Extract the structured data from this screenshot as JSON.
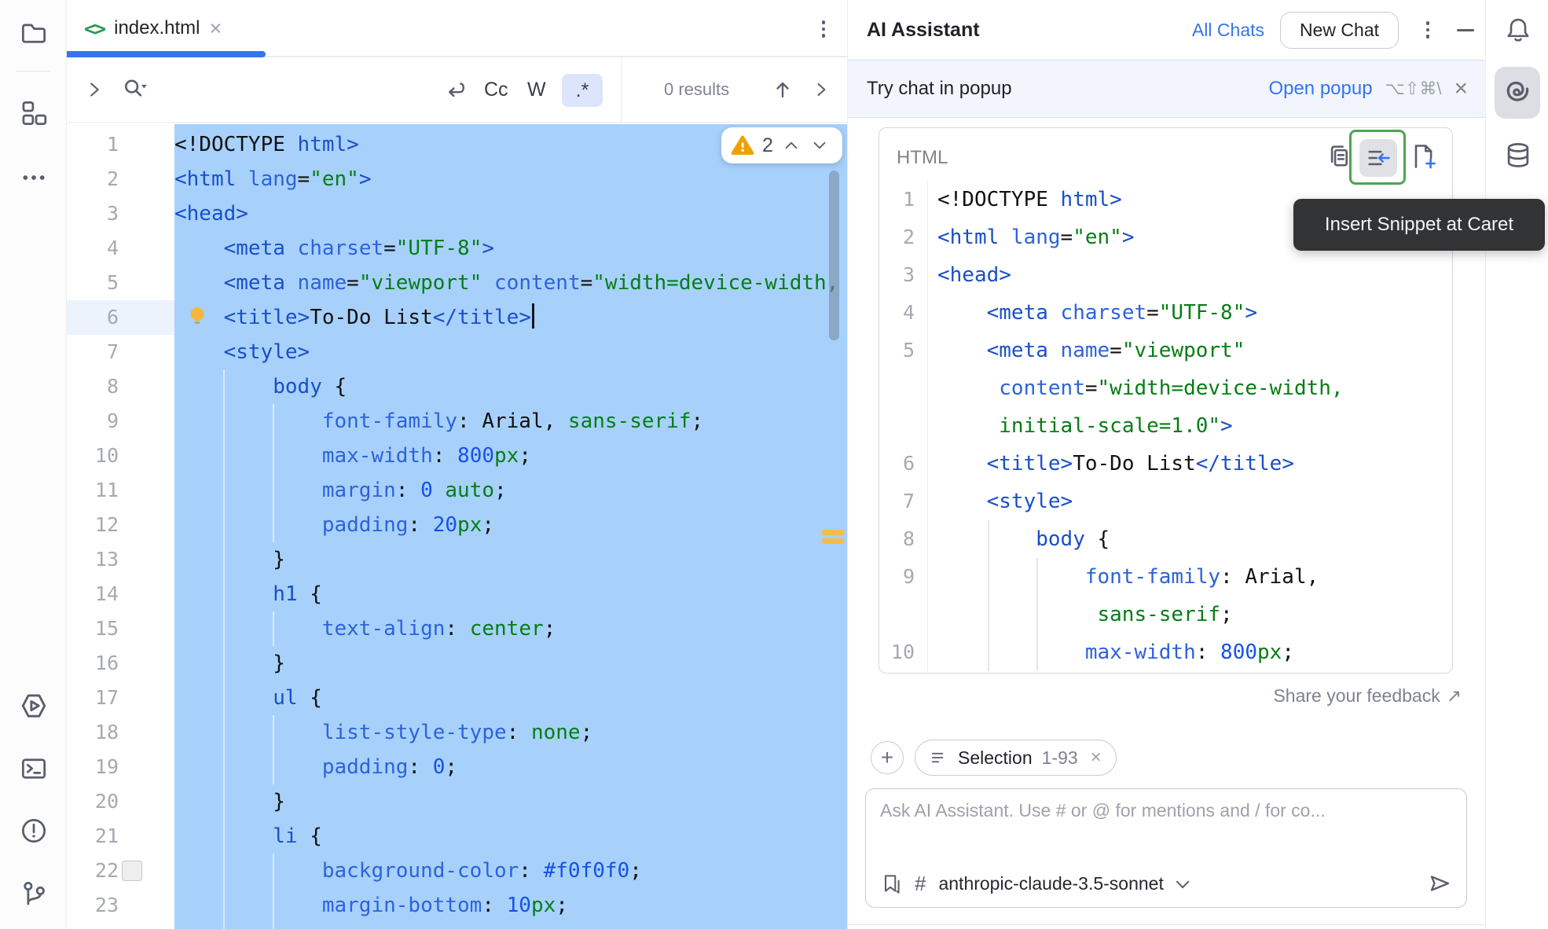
{
  "colors": {
    "accent": "#3574F0",
    "selection": "#A7D1FB",
    "warning": "#EDA200",
    "highlight_green": "#4BA64F",
    "link_blue": "#3574F0",
    "string_green": "#067D17",
    "tag_blue": "#1A4FC9"
  },
  "glyphs": {
    "close": "×",
    "plus": "+",
    "hash": "#",
    "code_icon": "<>",
    "feedback_arrow": "↗"
  },
  "tab": {
    "file": "index.html"
  },
  "search": {
    "results": "0 results",
    "match_case": "Cc",
    "words": "W",
    "regex": ".*"
  },
  "editor": {
    "warning_count": "2",
    "lines": [
      {
        "n": "1",
        "t": [
          [
            "t",
            "<!DOCTYPE "
          ],
          [
            "b",
            "html>"
          ]
        ]
      },
      {
        "n": "2",
        "t": [
          [
            "b",
            "<html "
          ],
          [
            "a",
            "lang"
          ],
          [
            "t",
            "="
          ],
          [
            "s",
            "\"en\""
          ],
          [
            "b",
            ">"
          ]
        ]
      },
      {
        "n": "3",
        "t": [
          [
            "b",
            "<head>"
          ]
        ]
      },
      {
        "n": "4",
        "t": [
          [
            "t",
            "    "
          ],
          [
            "b",
            "<meta "
          ],
          [
            "a",
            "charset"
          ],
          [
            "t",
            "="
          ],
          [
            "s",
            "\"UTF-8\""
          ],
          [
            "b",
            ">"
          ]
        ]
      },
      {
        "n": "5",
        "t": [
          [
            "t",
            "    "
          ],
          [
            "b",
            "<meta "
          ],
          [
            "a",
            "name"
          ],
          [
            "t",
            "="
          ],
          [
            "s",
            "\"viewport\""
          ],
          [
            "t",
            " "
          ],
          [
            "a",
            "content"
          ],
          [
            "t",
            "="
          ],
          [
            "s",
            "\"width=device-width,"
          ]
        ]
      },
      {
        "n": "6",
        "active": true,
        "bulb": true,
        "caret": true,
        "t": [
          [
            "t",
            "    "
          ],
          [
            "b",
            "<title>"
          ],
          [
            "t",
            "To-Do List"
          ],
          [
            "b",
            "</title>"
          ]
        ]
      },
      {
        "n": "7",
        "t": [
          [
            "t",
            "    "
          ],
          [
            "b",
            "<style>"
          ]
        ]
      },
      {
        "n": "8",
        "t": [
          [
            "t",
            "        "
          ],
          [
            "b",
            "body "
          ],
          [
            "t",
            "{"
          ]
        ]
      },
      {
        "n": "9",
        "t": [
          [
            "t",
            "            "
          ],
          [
            "a",
            "font-family"
          ],
          [
            "t",
            ": Arial, "
          ],
          [
            "s",
            "sans-serif"
          ],
          [
            "t",
            ";"
          ]
        ]
      },
      {
        "n": "10",
        "t": [
          [
            "t",
            "            "
          ],
          [
            "a",
            "max-width"
          ],
          [
            "t",
            ": "
          ],
          [
            "n",
            "800"
          ],
          [
            "s",
            "px"
          ],
          [
            "t",
            ";"
          ]
        ]
      },
      {
        "n": "11",
        "t": [
          [
            "t",
            "            "
          ],
          [
            "a",
            "margin"
          ],
          [
            "t",
            ": "
          ],
          [
            "n",
            "0"
          ],
          [
            "t",
            " "
          ],
          [
            "s",
            "auto"
          ],
          [
            "t",
            ";"
          ]
        ]
      },
      {
        "n": "12",
        "t": [
          [
            "t",
            "            "
          ],
          [
            "a",
            "padding"
          ],
          [
            "t",
            ": "
          ],
          [
            "n",
            "20"
          ],
          [
            "s",
            "px"
          ],
          [
            "t",
            ";"
          ]
        ]
      },
      {
        "n": "13",
        "t": [
          [
            "t",
            "        }"
          ]
        ]
      },
      {
        "n": "14",
        "t": [
          [
            "t",
            "        "
          ],
          [
            "b",
            "h1 "
          ],
          [
            "t",
            "{"
          ]
        ]
      },
      {
        "n": "15",
        "t": [
          [
            "t",
            "            "
          ],
          [
            "a",
            "text-align"
          ],
          [
            "t",
            ": "
          ],
          [
            "s",
            "center"
          ],
          [
            "t",
            ";"
          ]
        ]
      },
      {
        "n": "16",
        "t": [
          [
            "t",
            "        }"
          ]
        ]
      },
      {
        "n": "17",
        "t": [
          [
            "t",
            "        "
          ],
          [
            "b",
            "ul "
          ],
          [
            "t",
            "{"
          ]
        ]
      },
      {
        "n": "18",
        "t": [
          [
            "t",
            "            "
          ],
          [
            "a",
            "list-style-type"
          ],
          [
            "t",
            ": "
          ],
          [
            "s",
            "none"
          ],
          [
            "t",
            ";"
          ]
        ]
      },
      {
        "n": "19",
        "t": [
          [
            "t",
            "            "
          ],
          [
            "a",
            "padding"
          ],
          [
            "t",
            ": "
          ],
          [
            "n",
            "0"
          ],
          [
            "t",
            ";"
          ]
        ]
      },
      {
        "n": "20",
        "t": [
          [
            "t",
            "        }"
          ]
        ]
      },
      {
        "n": "21",
        "t": [
          [
            "t",
            "        "
          ],
          [
            "b",
            "li "
          ],
          [
            "t",
            "{"
          ]
        ]
      },
      {
        "n": "22",
        "chip": true,
        "t": [
          [
            "t",
            "            "
          ],
          [
            "a",
            "background-color"
          ],
          [
            "t",
            ": "
          ],
          [
            "n",
            "#f0f0f0"
          ],
          [
            "t",
            ";"
          ]
        ]
      },
      {
        "n": "23",
        "t": [
          [
            "t",
            "            "
          ],
          [
            "a",
            "margin-bottom"
          ],
          [
            "t",
            ": "
          ],
          [
            "n",
            "10"
          ],
          [
            "s",
            "px"
          ],
          [
            "t",
            ";"
          ]
        ]
      }
    ]
  },
  "ai": {
    "title": "AI Assistant",
    "all_chats": "All Chats",
    "new_chat": "New Chat",
    "banner": {
      "text": "Try chat in popup",
      "action": "Open popup",
      "shortcut": "⌥⇧⌘\\"
    },
    "snippet": {
      "lang": "HTML",
      "tooltip": "Insert Snippet at Caret",
      "rows": [
        {
          "n": "1",
          "t": [
            [
              "t",
              "<!DOCTYPE "
            ],
            [
              "b",
              "html>"
            ]
          ]
        },
        {
          "n": "2",
          "t": [
            [
              "b",
              "<html "
            ],
            [
              "a",
              "lang"
            ],
            [
              "t",
              "="
            ],
            [
              "s",
              "\"en\""
            ],
            [
              "b",
              ">"
            ]
          ]
        },
        {
          "n": "3",
          "t": [
            [
              "b",
              "<head>"
            ]
          ]
        },
        {
          "n": "4",
          "t": [
            [
              "t",
              "    "
            ],
            [
              "b",
              "<meta "
            ],
            [
              "a",
              "charset"
            ],
            [
              "t",
              "="
            ],
            [
              "s",
              "\"UTF-8\""
            ],
            [
              "b",
              ">"
            ]
          ]
        },
        {
          "n": "5",
          "t": [
            [
              "t",
              "    "
            ],
            [
              "b",
              "<meta "
            ],
            [
              "a",
              "name"
            ],
            [
              "t",
              "="
            ],
            [
              "s",
              "\"viewport\""
            ]
          ]
        },
        {
          "n": "",
          "t": [
            [
              "t",
              "     "
            ],
            [
              "a",
              "content"
            ],
            [
              "t",
              "="
            ],
            [
              "s",
              "\"width=device-width,"
            ]
          ]
        },
        {
          "n": "",
          "t": [
            [
              "t",
              "     "
            ],
            [
              "s",
              "initial-scale=1.0\""
            ],
            [
              "b",
              ">"
            ]
          ]
        },
        {
          "n": "6",
          "t": [
            [
              "t",
              "    "
            ],
            [
              "b",
              "<title>"
            ],
            [
              "t",
              "To-Do List"
            ],
            [
              "b",
              "</title>"
            ]
          ]
        },
        {
          "n": "7",
          "t": [
            [
              "t",
              "    "
            ],
            [
              "b",
              "<style>"
            ]
          ]
        },
        {
          "n": "8",
          "t": [
            [
              "t",
              "        "
            ],
            [
              "b",
              "body "
            ],
            [
              "t",
              "{"
            ]
          ]
        },
        {
          "n": "9",
          "t": [
            [
              "t",
              "            "
            ],
            [
              "a",
              "font-family"
            ],
            [
              "t",
              ": Arial,"
            ]
          ]
        },
        {
          "n": "",
          "t": [
            [
              "t",
              "             "
            ],
            [
              "s",
              "sans-serif"
            ],
            [
              "t",
              ";"
            ]
          ]
        },
        {
          "n": "10",
          "t": [
            [
              "t",
              "            "
            ],
            [
              "a",
              "max-width"
            ],
            [
              "t",
              ": "
            ],
            [
              "n",
              "800"
            ],
            [
              "s",
              "px"
            ],
            [
              "t",
              ";"
            ]
          ]
        }
      ]
    },
    "feedback": "Share your feedback",
    "chip": {
      "label": "Selection",
      "range": "1-93"
    },
    "input": {
      "placeholder": "Ask AI Assistant. Use # or @ for mentions and / for co...",
      "model": "anthropic-claude-3.5-sonnet"
    }
  }
}
